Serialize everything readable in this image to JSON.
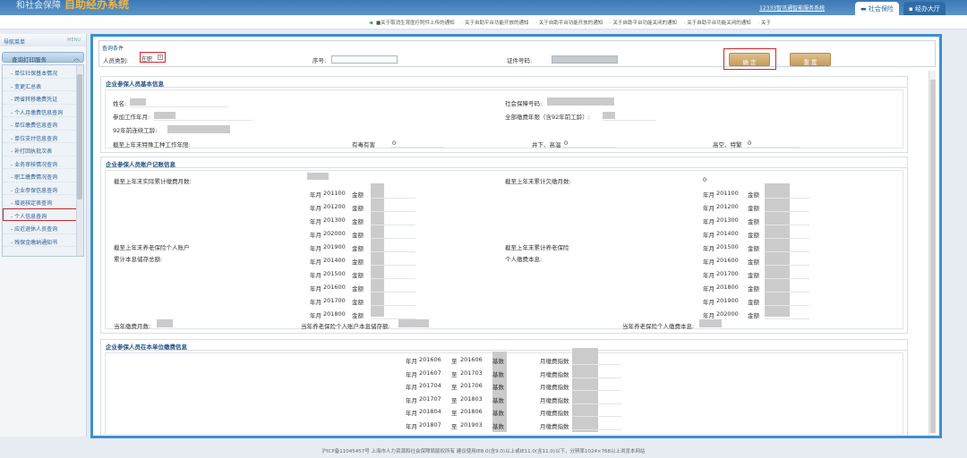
{
  "header": {
    "logo_text": "和社会保障",
    "logo_highlight": "自助经办系统",
    "portal_link": "12333智讯通智能服务系统",
    "tabs": [
      "社会保险",
      "经办大厅"
    ]
  },
  "notices": {
    "items": [
      "■关于取消生育医疗附件上传的通知",
      "关于自助平台功能开放的通知",
      "关于自助平台功能开放的通知",
      "关于自助平台功能关闭的通知",
      "关于自助平台功能关闭的通知",
      "关于"
    ]
  },
  "sidebar": {
    "header": "导航菜单",
    "header_right": "MENU",
    "group": "查询打印服务",
    "items": [
      "单位社保基本情况",
      "变更汇总表",
      "跨省转移缴费凭证",
      "个人月缴费信息查询",
      "单位缴费信息查询",
      "单位支付信息查询",
      "补打回执批次表",
      "业务审核情况查询",
      "职工缴费情况查询",
      "企业参保信息查询",
      "增退核定表查询",
      "个人信息查询",
      "应近退休人员查询",
      "残保金缴纳通知书"
    ],
    "active_index": 11
  },
  "query": {
    "title": "查询条件",
    "status_label": "人员类别:",
    "status_value": "在职",
    "seq_label": "序号:",
    "id_label": "证件号码:",
    "confirm": "确 定",
    "reset": "重 置"
  },
  "basic_info": {
    "title": "企业参保人员基本信息",
    "name_label": "姓名:",
    "ss_no_label": "社会保障号码:",
    "work_start_label": "参加工作年月:",
    "total_months_label": "全部缴费年限（含92年前工龄）:",
    "pre92_label": "92年前连续工龄:",
    "special_label": "截至上年末特殊工种工作年限:",
    "toxic_label": "有毒有害",
    "toxic_value": "0",
    "mine_label": "井下、高温",
    "mine_value": "0",
    "alt_label": "高空、特繁",
    "alt_value": "0"
  },
  "account_info": {
    "title": "企业参保人员账户记账信息",
    "paid_months_label": "截至上年末实际累计缴费月数:",
    "arrears_label": "截至上年末累计欠缴月数:",
    "arrears_value": "0",
    "personal_acct_label_1": "截至上年末养老保险个人账户",
    "personal_acct_label_2": "累计本息储存总额:",
    "principal_label_1": "截至上年末累计养老保险",
    "principal_label_2": "个人缴费本息:",
    "month_label": "年月",
    "amount_label": "金额",
    "left_rows": [
      "201100",
      "201200",
      "201300",
      "202000",
      "201900",
      "201400",
      "201500",
      "201600",
      "201700",
      "201800"
    ],
    "right_rows": [
      "201100",
      "201200",
      "201300",
      "201400",
      "201500",
      "201600",
      "201700",
      "201800",
      "201900",
      "202000"
    ],
    "current_months_label": "当年缴费月数:",
    "current_acct_label": "当年养老保险个人账户本息储存额:",
    "current_principal_label": "当年养老保险个人缴费本息:"
  },
  "unit_info": {
    "title": "企业参保人员在本单位缴费信息",
    "month_label": "年月",
    "to_label": "至",
    "base_label": "基数",
    "fee_label": "月缴费指数",
    "rows": [
      {
        "from": "201606",
        "to": "201606"
      },
      {
        "from": "201607",
        "to": "201703"
      },
      {
        "from": "201704",
        "to": "201706"
      },
      {
        "from": "201707",
        "to": "201803"
      },
      {
        "from": "201804",
        "to": "201806"
      },
      {
        "from": "201807",
        "to": "201903"
      }
    ]
  },
  "footer": "沪ICP备11045457号    上海市人力资源和社会保障局版权所有  建议使用IE8.0(含9.0)以上或IE11.0(含11.0)以下，分辨率1024×768以上浏览本网站"
}
